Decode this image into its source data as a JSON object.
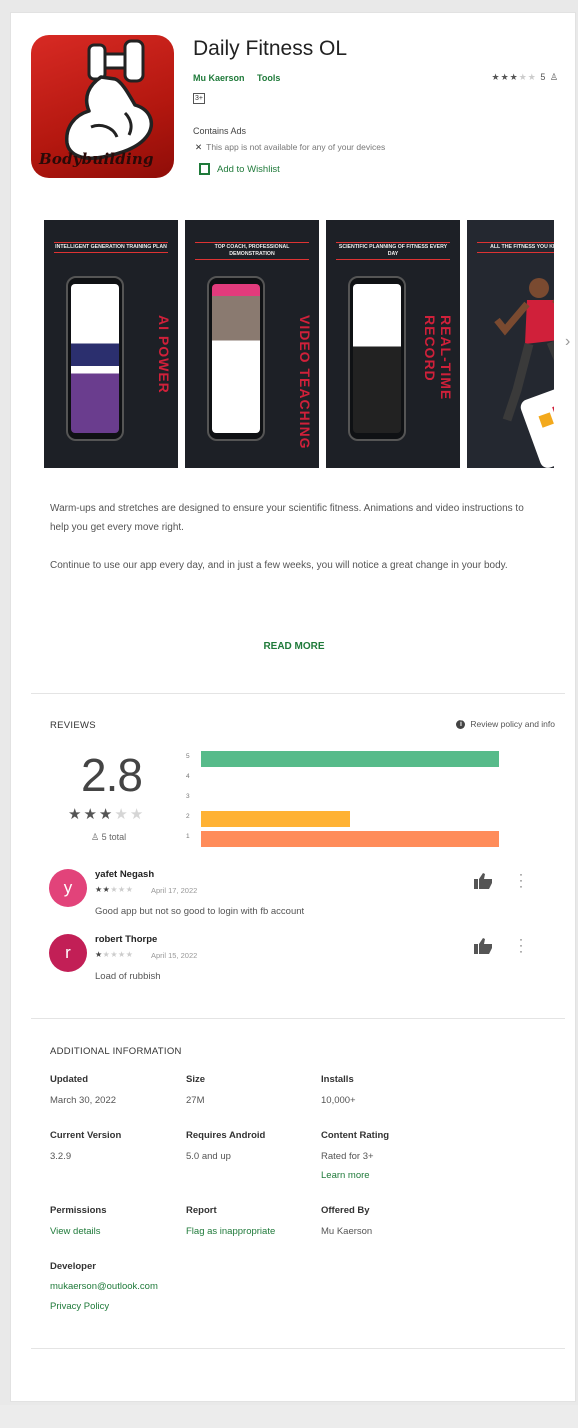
{
  "app": {
    "title": "Daily Fitness OL",
    "developer": "Mu Kaerson",
    "category": "Tools",
    "icon_text": "Bodybuilding",
    "rating_stars": 3,
    "rating_count": "5",
    "content_badge": "3+",
    "contains_ads": "Contains Ads",
    "availability": "This app is not available for any of your devices",
    "wishlist": "Add to Wishlist"
  },
  "screenshots": [
    {
      "caption": "INTELLIGENT GENERATION TRAINING PLAN",
      "side_text": "AI POWER"
    },
    {
      "caption": "TOP COACH, PROFESSIONAL DEMONSTRATION",
      "side_text": "VIDEO TEACHING"
    },
    {
      "caption": "SCIENTIFIC PLANNING OF FITNESS EVERY DAY",
      "side_text": "REAL-TIME RECORD"
    },
    {
      "caption": "ALL THE FITNESS YOU KNOW ARE",
      "side_text": ""
    }
  ],
  "description": {
    "p1": "Warm-ups and stretches are designed to ensure your scientific fitness. Animations and video instructions to help you get every move right.",
    "p2": "Continue to use our app every day, and in just a few weeks, you will notice a great change in your body.",
    "read_more": "READ MORE"
  },
  "reviews": {
    "heading": "REVIEWS",
    "policy": "Review policy and info",
    "average": "2.8",
    "stars": 3,
    "total": "5 total",
    "histogram": [
      {
        "label": "5",
        "fraction": 1.0,
        "color": "#57bb8a"
      },
      {
        "label": "4",
        "fraction": 0.0,
        "color": "#9ace6a"
      },
      {
        "label": "3",
        "fraction": 0.0,
        "color": "#ffcf02"
      },
      {
        "label": "2",
        "fraction": 0.5,
        "color": "#ffb234"
      },
      {
        "label": "1",
        "fraction": 1.0,
        "color": "#ff8c5a"
      }
    ],
    "items": [
      {
        "initial": "y",
        "name": "yafet Negash",
        "stars": 2,
        "date": "April 17, 2022",
        "text": "Good app but not so good to login with fb account",
        "avatar_color": "#e2437a"
      },
      {
        "initial": "r",
        "name": "robert Thorpe",
        "stars": 1,
        "date": "April 15, 2022",
        "text": "Load of rubbish",
        "avatar_color": "#c21f56"
      }
    ]
  },
  "additional": {
    "heading": "ADDITIONAL INFORMATION",
    "updated_label": "Updated",
    "updated": "March 30, 2022",
    "size_label": "Size",
    "size": "27M",
    "installs_label": "Installs",
    "installs": "10,000+",
    "version_label": "Current Version",
    "version": "3.2.9",
    "android_label": "Requires Android",
    "android": "5.0 and up",
    "content_label": "Content Rating",
    "content": "Rated for 3+",
    "learn_more": "Learn more",
    "permissions_label": "Permissions",
    "permissions": "View details",
    "report_label": "Report",
    "report": "Flag as inappropriate",
    "offered_label": "Offered By",
    "offered": "Mu Kaerson",
    "developer_label": "Developer",
    "email": "mukaerson@outlook.com",
    "privacy": "Privacy Policy"
  }
}
